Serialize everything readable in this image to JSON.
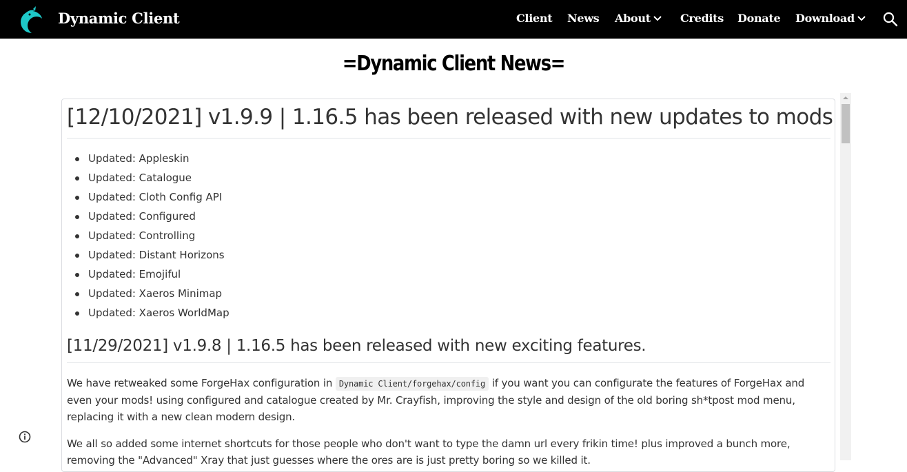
{
  "site": {
    "title": "Dynamic Client"
  },
  "nav": {
    "client": "Client",
    "news": "News",
    "about": "About",
    "credits": "Credits",
    "donate": "Donate",
    "download": "Download"
  },
  "page": {
    "title": "=Dynamic Client News="
  },
  "release1": {
    "heading": "[12/10/2021] v1.9.9 | 1.16.5 has been released with new updates to mods.",
    "items": [
      "Updated: Appleskin",
      "Updated: Catalogue",
      "Updated: Cloth Config API",
      "Updated: Configured",
      "Updated: Controlling",
      "Updated: Distant Horizons",
      "Updated: Emojiful",
      "Updated: Xaeros Minimap",
      "Updated: Xaeros WorldMap"
    ]
  },
  "release2": {
    "heading": "[11/29/2021] v1.9.8 | 1.16.5 has been released with new exciting features.",
    "p1_before": "We have retweaked some ForgeHax configuration in ",
    "p1_code": "Dynamic Client/forgehax/config",
    "p1_after": " if you want you can configurate the features of ForgeHax and even your mods! using configured and catalogue created by Mr. Crayfish, improving the style and design of the old boring sh*tpost mod menu, replacing it with a new clean modern design.",
    "p2": "We all so added some internet shortcuts for those people who don't want to type the damn url every frikin time! plus improved a bunch more, removing the \"Advanced\" Xray that just guesses where the ores are is just pretty boring so we killed it."
  }
}
